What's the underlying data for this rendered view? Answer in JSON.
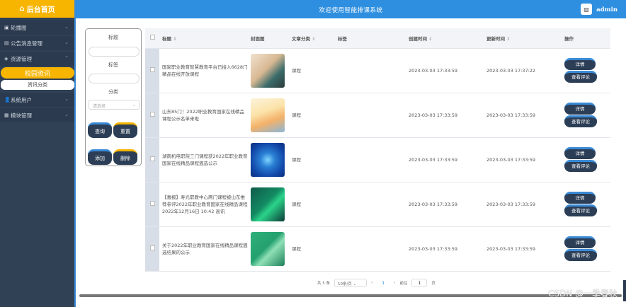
{
  "sidebar": {
    "logo_icon": "⌂",
    "logo": "后台首页",
    "menus": [
      {
        "icon": "▣",
        "label": "轮播图"
      },
      {
        "icon": "▤",
        "label": "公告消息管理"
      },
      {
        "icon": "◈",
        "label": "资源管理"
      }
    ],
    "active_sub": "校园资讯",
    "sub2": "资讯分类",
    "menus2": [
      {
        "icon": "👤",
        "label": "系统用户"
      },
      {
        "icon": "▦",
        "label": "模块管理"
      }
    ]
  },
  "header": {
    "title": "欢迎使用智能排课系统",
    "username": "admin"
  },
  "filter": {
    "title_label": "标题",
    "tag_label": "标签",
    "category_label": "分类",
    "category_placeholder": "请选择",
    "query": "查询",
    "reset": "重置",
    "add": "添加",
    "delete": "删除"
  },
  "table": {
    "columns": [
      "标题",
      "封面图",
      "文章分类",
      "标签",
      "创建时间",
      "更新时间",
      "操作"
    ],
    "detail_label": "详情",
    "comment_label": "查看评论",
    "rows": [
      {
        "title": "国家职业教育智慧教育平台已接入6628门精品在线开放课程",
        "category": "课程",
        "tag": "",
        "created": "2023-03-03 17:33:59",
        "updated": "2023-03-03 17:37:22"
      },
      {
        "title": "山东85门！2022职业教育国家在线精品课程公示名单来啦",
        "category": "课程",
        "tag": "",
        "created": "2023-03-03 17:33:59",
        "updated": "2023-03-03 17:33:59"
      },
      {
        "title": "湖南机电职院三门课程获2022年职业教育国家在线精品课程遴选公示",
        "category": "课程",
        "tag": "",
        "created": "2023-03-03 17:33:59",
        "updated": "2023-03-03 17:33:59"
      },
      {
        "title": "【喜报】寿光职教中心两门课程被山东推荐参评2022年职业教育国家在线精品课程 2022年12月16日 10:42 高讯",
        "category": "课程",
        "tag": "",
        "created": "2023-03-03 17:33:59",
        "updated": "2023-03-03 17:33:59"
      },
      {
        "title": "关于2022年职业教育国家在线精品课程遴选结果的公示",
        "category": "课程",
        "tag": "",
        "created": "2023-03-03 17:33:59",
        "updated": "2023-03-03 17:33:59"
      }
    ]
  },
  "pagination": {
    "total": "共 5 条",
    "page_size": "10条/页",
    "prev": "‹",
    "current": "1",
    "next": "›",
    "goto": "前往",
    "goto_value": "1",
    "page_unit": "页"
  },
  "watermark": "CSDN @一季春秋",
  "colors": {
    "accent": "#2e8fe0",
    "sidebar": "#304156",
    "highlight": "#f7b500"
  }
}
